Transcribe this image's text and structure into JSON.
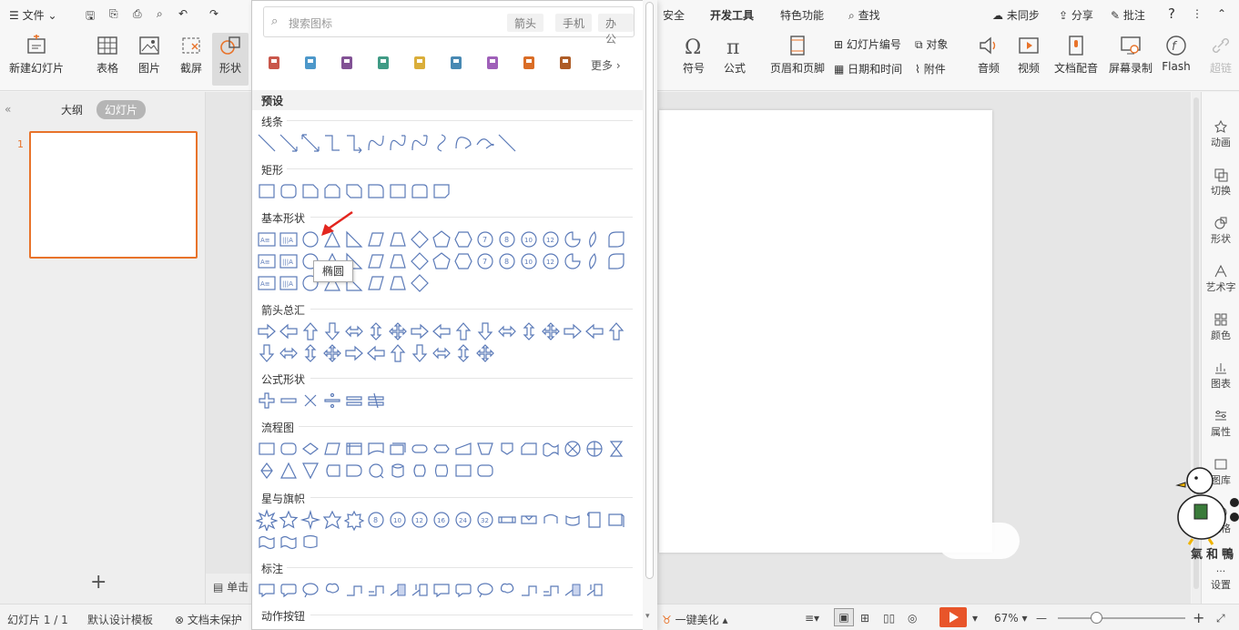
{
  "tabbar": {
    "file_menu": "文件",
    "tabs": [
      "安全",
      "开发工具",
      "特色功能"
    ],
    "search": "查找",
    "sync": "未同步",
    "share": "分享",
    "comment": "批注",
    "help": "?"
  },
  "ribbon": {
    "new_slide": "新建幻灯片",
    "table": "表格",
    "picture": "图片",
    "screenshot": "截屏",
    "shape": "形状",
    "symbol": "符号",
    "formula": "公式",
    "header_footer": "页眉和页脚",
    "slide_number": "幻灯片编号",
    "object": "对象",
    "date_time": "日期和时间",
    "attachment": "附件",
    "audio": "音频",
    "video": "视频",
    "doc_voice": "文档配音",
    "screen_record": "屏幕录制",
    "flash": "Flash",
    "hyperlink": "超链"
  },
  "left_panel": {
    "tab_outline": "大纲",
    "tab_slides": "幻灯片",
    "slide_number": "1",
    "add_label": "+"
  },
  "notes": {
    "label": "单击"
  },
  "right_sidebar": [
    "动画",
    "切换",
    "形状",
    "艺术字",
    "颜色",
    "图表",
    "属性",
    "图库",
    "风格",
    "设置"
  ],
  "statusbar": {
    "slide_count": "幻灯片 1 / 1",
    "template": "默认设计模板",
    "protect": "文档未保护",
    "beautify": "一键美化",
    "zoom": "67%"
  },
  "shape_panel": {
    "search_placeholder": "搜索图标",
    "chips": [
      "箭头",
      "手机",
      "办公"
    ],
    "more": "更多",
    "preset_label": "预设",
    "sections": [
      {
        "title": "线条",
        "count": 12
      },
      {
        "title": "矩形",
        "count": 9
      },
      {
        "title": "基本形状",
        "count": 42
      },
      {
        "title": "箭头总汇",
        "count": 28
      },
      {
        "title": "公式形状",
        "count": 6
      },
      {
        "title": "流程图",
        "count": 28
      },
      {
        "title": "星与旗帜",
        "count": 20
      },
      {
        "title": "标注",
        "count": 16
      },
      {
        "title": "动作按钮",
        "count": 0
      }
    ],
    "tooltip": "椭圆"
  },
  "watermark": "氣和鴨",
  "colors": {
    "accent": "#e8732a",
    "shape_stroke": "#5b7ab8",
    "play": "#e8552a"
  }
}
